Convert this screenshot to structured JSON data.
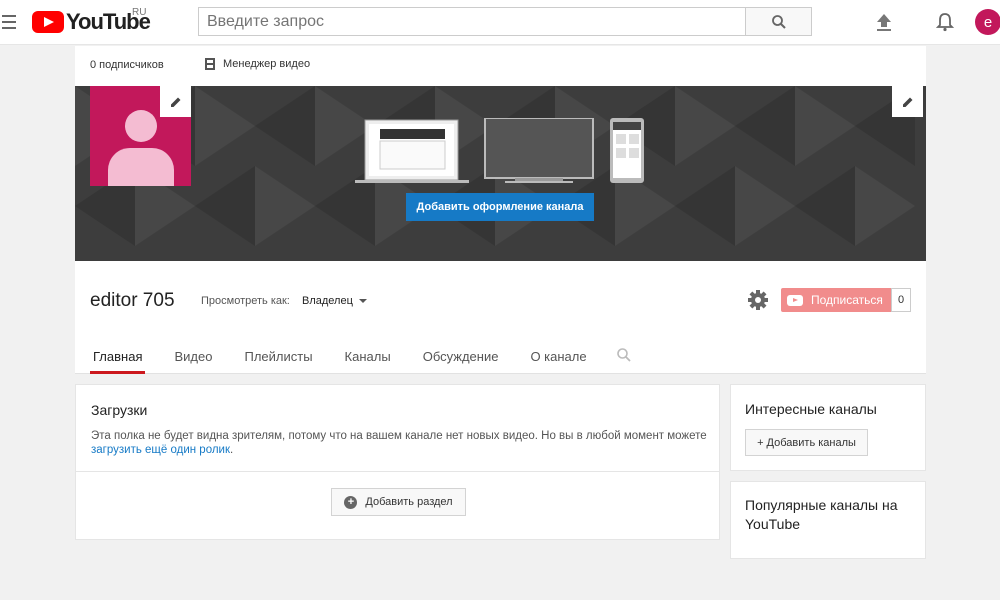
{
  "masthead": {
    "logo_text": "YouTube",
    "logo_region": "RU",
    "search_placeholder": "Введите запрос",
    "avatar_letter": "e"
  },
  "channel": {
    "subscribers": "0 подписчиков",
    "video_manager": "Менеджер видео",
    "banner_button": "Добавить оформление канала",
    "name": "editor 705",
    "view_as_label": "Просмотреть как:",
    "view_as_value": "Владелец",
    "subscribe_label": "Подписаться",
    "subscribe_count": "0",
    "tabs": [
      "Главная",
      "Видео",
      "Плейлисты",
      "Каналы",
      "Обсуждение",
      "О канале"
    ]
  },
  "uploads": {
    "title": "Загрузки",
    "description": "Эта полка не будет видна зрителям, потому что на вашем канале нет новых видео. Но вы в любой момент можете",
    "link": "загрузить ещё один ролик",
    "period": ".",
    "add_section": "Добавить раздел"
  },
  "sidebar": {
    "interesting_title": "Интересные каналы",
    "add_channels": "+ Добавить каналы",
    "popular_title": "Популярные каналы на YouTube"
  },
  "colors": {
    "brand_red": "#ff0000",
    "avatar_pink": "#c2185b",
    "primary_blue": "#167ac6",
    "subscribe_red": "#f18c8c"
  }
}
